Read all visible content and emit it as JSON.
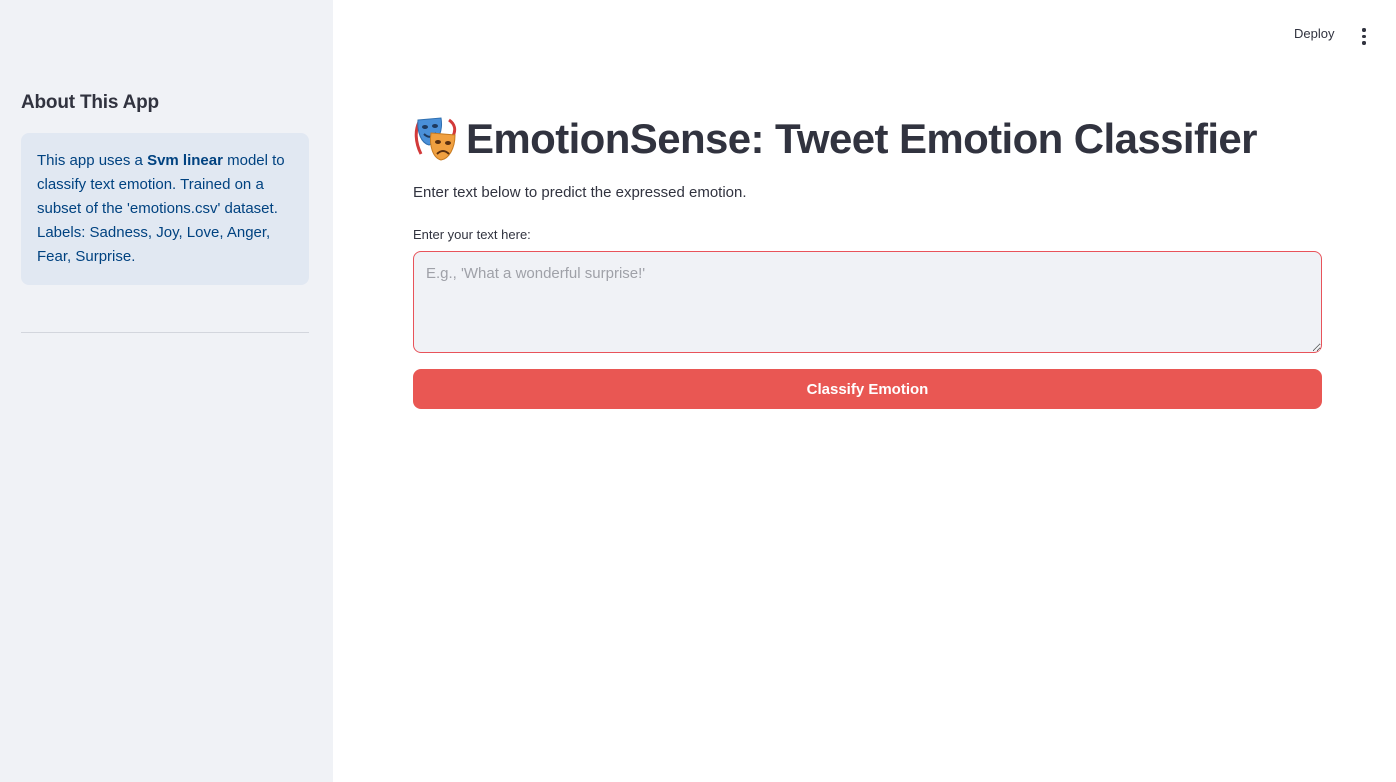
{
  "header": {
    "deploy_label": "Deploy",
    "menu_icon": "more-vertical-icon"
  },
  "sidebar": {
    "heading": "About This App",
    "info": {
      "prefix": "This app uses a ",
      "model_name": "Svm linear",
      "suffix": " model to classify text emotion. Trained on a subset of the 'emotions.csv' dataset. Labels: Sadness, Joy, Love, Anger, Fear, Surprise."
    }
  },
  "main": {
    "title_icon": "performing-arts-masks-icon",
    "title": "EmotionSense: Tweet Emotion Classifier",
    "subtitle": "Enter text below to predict the expressed emotion.",
    "input": {
      "label": "Enter your text here:",
      "placeholder": "E.g., 'What a wonderful surprise!'",
      "value": ""
    },
    "classify_label": "Classify Emotion"
  },
  "colors": {
    "primary": "#e95753",
    "sidebar_bg": "#f0f2f6",
    "info_bg": "#e1e8f2",
    "info_text": "#004280",
    "text": "#31333f"
  }
}
